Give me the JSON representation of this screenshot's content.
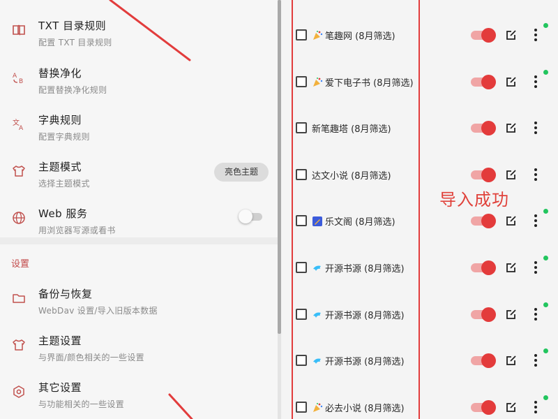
{
  "left": {
    "items": [
      {
        "title": "TXT 目录规则",
        "subtitle": "配置 TXT 目录规则",
        "icon": "book-icon"
      },
      {
        "title": "替换净化",
        "subtitle": "配置替换净化规则",
        "icon": "replace-icon"
      },
      {
        "title": "字典规则",
        "subtitle": "配置字典规则",
        "icon": "translate-icon"
      },
      {
        "title": "主题模式",
        "subtitle": "选择主题模式",
        "icon": "tshirt-icon"
      },
      {
        "title": "Web 服务",
        "subtitle": "用浏览器写源或看书",
        "icon": "globe-icon"
      }
    ],
    "theme_chip": "亮色主题",
    "section_header": "设置",
    "settings": [
      {
        "title": "备份与恢复",
        "subtitle": "WebDav 设置/导入旧版本数据",
        "icon": "folder-icon"
      },
      {
        "title": "主题设置",
        "subtitle": "与界面/颜色相关的一些设置",
        "icon": "tshirt-icon"
      },
      {
        "title": "其它设置",
        "subtitle": "与功能相关的一些设置",
        "icon": "settings-icon"
      }
    ]
  },
  "sources": [
    {
      "label": "笔趣网 (8月筛选)",
      "emoji": "party",
      "status": true
    },
    {
      "label": "爱下电子书 (8月筛选)",
      "emoji": "party",
      "status": true
    },
    {
      "label": "新笔趣塔 (8月筛选)",
      "emoji": "",
      "status": false
    },
    {
      "label": "达文小说 (8月筛选)",
      "emoji": "",
      "status": false
    },
    {
      "label": "乐文阁 (8月筛选)",
      "emoji": "pencil",
      "status": true
    },
    {
      "label": "开源书源 (8月筛选)",
      "emoji": "dolphin",
      "status": true
    },
    {
      "label": "开源书源 (8月筛选)",
      "emoji": "dolphin",
      "status": true
    },
    {
      "label": "开源书源 (8月筛选)",
      "emoji": "dolphin",
      "status": true
    },
    {
      "label": "必去小说 (8月筛选)",
      "emoji": "party",
      "status": true
    }
  ],
  "annotation": "导入成功",
  "colors": {
    "accent": "#e33b3b",
    "accent_light": "#f0a5a5",
    "status_green": "#22c55e",
    "icon_red": "#c0504d"
  }
}
